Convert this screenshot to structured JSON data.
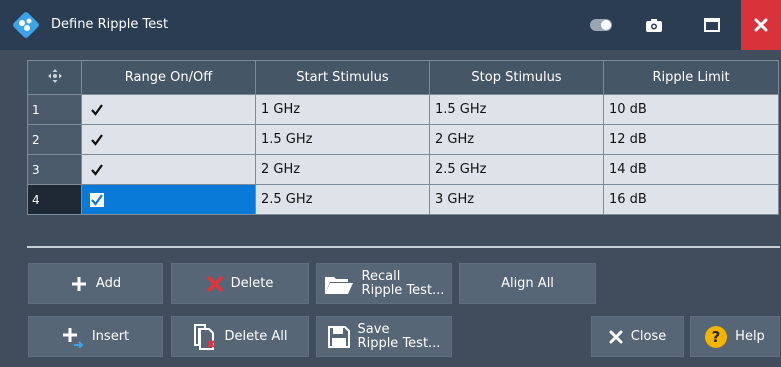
{
  "window": {
    "title": "Define Ripple Test"
  },
  "table": {
    "headers": [
      "Range On/Off",
      "Start Stimulus",
      "Stop Stimulus",
      "Ripple Limit"
    ],
    "rows": [
      {
        "num": "1",
        "on": true,
        "start": "1 GHz",
        "stop": "1.5 GHz",
        "limit": "10 dB"
      },
      {
        "num": "2",
        "on": true,
        "start": "1.5 GHz",
        "stop": "2 GHz",
        "limit": "12 dB"
      },
      {
        "num": "3",
        "on": true,
        "start": "2 GHz",
        "stop": "2.5 GHz",
        "limit": "14 dB"
      },
      {
        "num": "4",
        "on": true,
        "start": "2.5 GHz",
        "stop": "3 GHz",
        "limit": "16 dB"
      }
    ]
  },
  "buttons": {
    "add": "Add",
    "delete": "Delete",
    "recall_line1": "Recall",
    "recall_line2": "Ripple Test...",
    "align_all": "Align All",
    "insert": "Insert",
    "delete_all": "Delete All",
    "save_line1": "Save",
    "save_line2": "Ripple Test...",
    "close": "Close",
    "help": "Help"
  },
  "colors": {
    "title_bar": "#2a3d52",
    "close_button": "#d8333b",
    "selected_cell": "#0a7ad8",
    "help_icon": "#f5b400",
    "delete_icon": "#e8323a"
  }
}
